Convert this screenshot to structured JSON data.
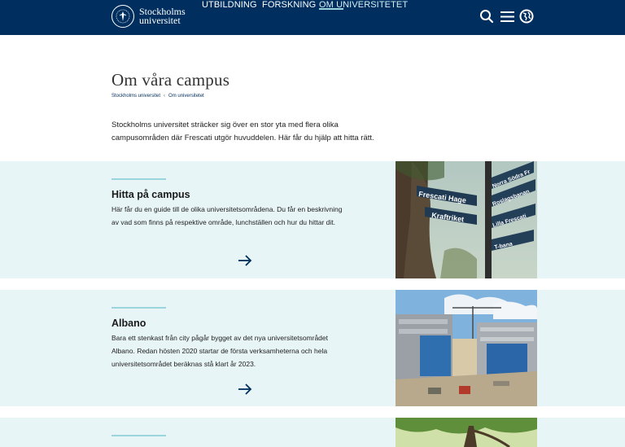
{
  "header": {
    "logo_line1": "Stockholms",
    "logo_line2": "universitet",
    "nav": [
      {
        "label": "UTBILDNING",
        "active": false
      },
      {
        "label": "FORSKNING",
        "active": false
      },
      {
        "label": "OM UNIVERSITETET",
        "active": true
      }
    ],
    "icons": [
      "search-icon",
      "menu-icon",
      "globe-icon"
    ],
    "colors": {
      "bar": "#002f5f",
      "accent": "#9ad4dc"
    }
  },
  "page": {
    "title": "Om våra campus",
    "breadcrumb": [
      "Stockholms universitet",
      "Om universitetet"
    ],
    "breadcrumb_separator": "‹",
    "intro_line1": "Stockholms universitet sträcker sig över en stor yta med flera olika",
    "intro_line2": "campusområden där Frescati utgör huvuddelen. Här får du hjälp att hitta rätt."
  },
  "cards": [
    {
      "title": "Hitta på campus",
      "text_line1": "Här får du en guide till de olika universitetsområdena. Du får en beskrivning",
      "text_line2": "av vad som finns på respektive område, lunchställen och hur du hittar dit.",
      "image": "signposts-photo",
      "signs": [
        "Frescati Hage",
        "Kraftriket",
        "Norra Södra Fr",
        "Roslagsbanan",
        "Lilla Frescati",
        "T-bana"
      ]
    },
    {
      "title": "Albano",
      "text_line1": "Bara ett stenkast från city pågår bygget av det nya universitetsområdet",
      "text_line2": "Albano. Redan hösten 2020 startar de första verksamheterna och hela",
      "text_line3": "universitetsområdet beräknas stå klart år 2023.",
      "image": "construction-site-photo"
    },
    {
      "image": "tree-photo"
    }
  ]
}
